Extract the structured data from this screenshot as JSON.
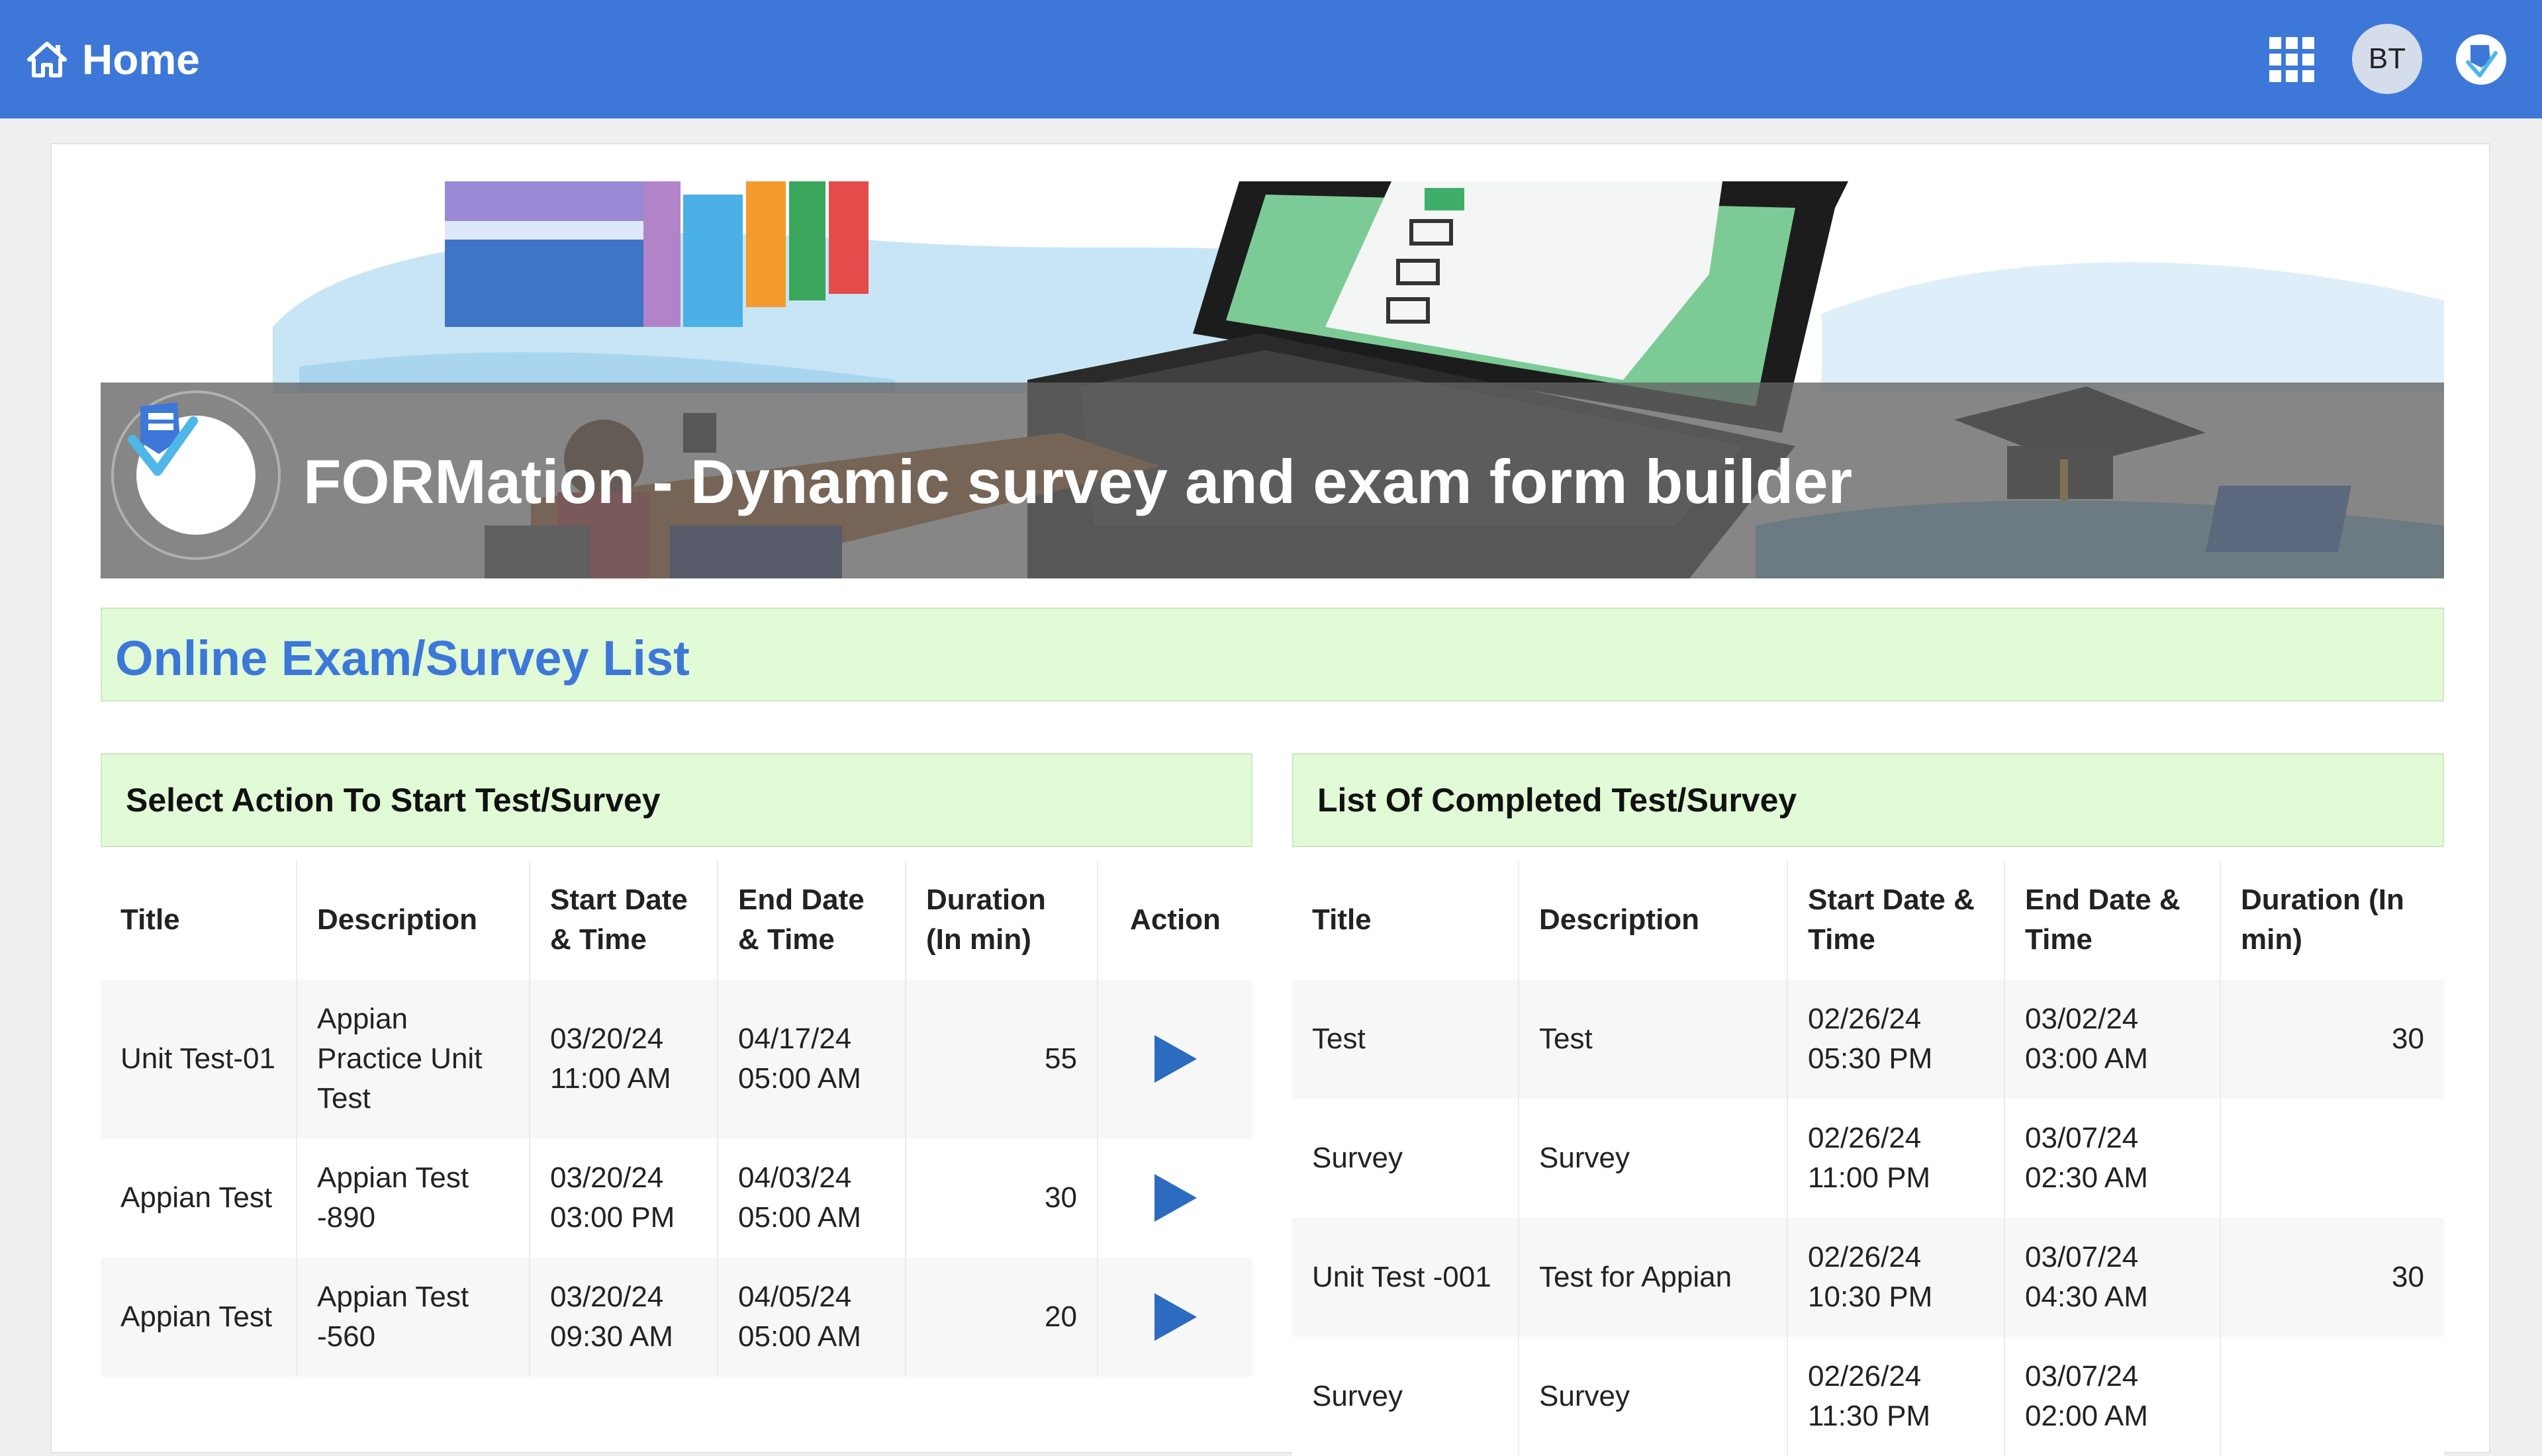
{
  "header": {
    "home_label": "Home",
    "avatar_initials": "BT",
    "bar_color": "#3d78d8"
  },
  "banner": {
    "title": "FORMation - Dynamic survey and exam form builder"
  },
  "section": {
    "title": "Online Exam/Survey List",
    "title_color": "#3d78d8",
    "heading_bg": "#e1fbd6"
  },
  "start_panel": {
    "title": "Select Action To Start Test/Survey",
    "columns": [
      "Title",
      "Description",
      "Start Date & Time",
      "End Date & Time",
      "Duration (In min)",
      "Action"
    ],
    "rows": [
      {
        "title": "Unit Test-01",
        "description": "Appian Practice Unit Test",
        "start": "03/20/24 11:00 AM",
        "end": "04/17/24 05:00 AM",
        "duration": "55",
        "action_icon": "play-icon"
      },
      {
        "title": "Appian Test",
        "description": "Appian Test -890",
        "start": "03/20/24 03:00 PM",
        "end": "04/03/24 05:00 AM",
        "duration": "30",
        "action_icon": "play-icon"
      },
      {
        "title": "Appian Test",
        "description": "Appian Test -560",
        "start": "03/20/24 09:30 AM",
        "end": "04/05/24 05:00 AM",
        "duration": "20",
        "action_icon": "play-icon"
      }
    ]
  },
  "completed_panel": {
    "title": "List Of Completed Test/Survey",
    "columns": [
      "Title",
      "Description",
      "Start Date & Time",
      "End Date & Time",
      "Duration (In min)"
    ],
    "rows": [
      {
        "title": "Test",
        "description": "Test",
        "start": "02/26/24 05:30 PM",
        "end": "03/02/24 03:00 AM",
        "duration": "30"
      },
      {
        "title": "Survey",
        "description": "Survey",
        "start": "02/26/24 11:00 PM",
        "end": "03/07/24 02:30 AM",
        "duration": ""
      },
      {
        "title": "Unit Test -001",
        "description": "Test for Appian",
        "start": "02/26/24 10:30 PM",
        "end": "03/07/24 04:30 AM",
        "duration": "30"
      },
      {
        "title": "Survey",
        "description": "Survey",
        "start": "02/26/24 11:30 PM",
        "end": "03/07/24 02:00 AM",
        "duration": ""
      }
    ]
  }
}
